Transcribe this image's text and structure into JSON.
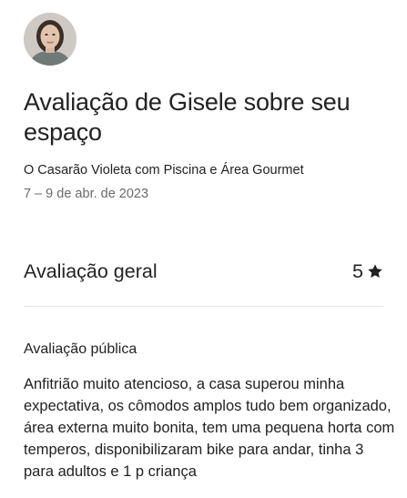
{
  "reviewer": {
    "avatar_alt": "Gisele"
  },
  "header": {
    "title": "Avaliação de Gisele sobre seu espaço",
    "listing_name": "O Casarão Violeta com Piscina e Área Gourmet",
    "stay_dates": "7 – 9 de abr. de 2023"
  },
  "overall_rating": {
    "label": "Avaliação geral",
    "score": "5",
    "icon": "star-icon"
  },
  "public_review": {
    "heading": "Avaliação pública",
    "text": "Anfitrião muito atencioso, a casa superou minha expectativa, os cômodos amplos tudo bem organizado, área externa muito bonita, tem uma pequena horta com temperos, disponibilizaram bike para andar, tinha 3 para adultos e 1 p criança"
  },
  "colors": {
    "text_primary": "#222222",
    "text_secondary": "#6a6a6a",
    "divider": "#e4e4e4"
  }
}
